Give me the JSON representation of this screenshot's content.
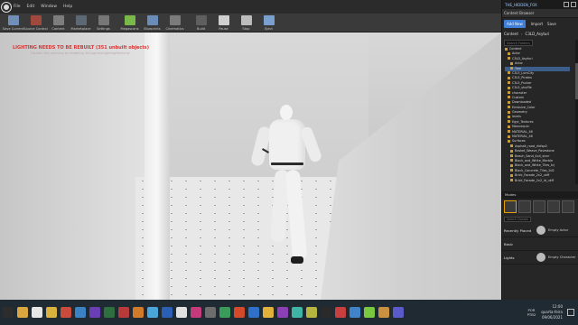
{
  "menu": {
    "items": [
      "File",
      "Edit",
      "Window",
      "Help"
    ]
  },
  "toolbar": {
    "buttons": [
      {
        "label": "Save Current",
        "color": "#6f8fb6"
      },
      {
        "label": "Source Control",
        "color": "#a0483b"
      },
      {
        "label": "Content",
        "color": "#7d7d7d"
      },
      {
        "label": "Marketplace",
        "color": "#5d6875"
      },
      {
        "label": "Settings",
        "color": "#777777"
      },
      {
        "label": "Megascans",
        "color": "#7ab84a"
      },
      {
        "label": "Blueprints",
        "color": "#6a8db8"
      },
      {
        "label": "Cinematics",
        "color": "#7b7b7b"
      },
      {
        "label": "Build",
        "color": "#5f5f5f"
      },
      {
        "label": "Pause",
        "color": "#cfcfcf"
      },
      {
        "label": "Stop",
        "color": "#bcbcbc"
      },
      {
        "label": "Eject",
        "color": "#7aa0d0"
      }
    ]
  },
  "viewport": {
    "warning": "LIGHTING NEEDS TO BE REBUILT (351 unbuilt objects)",
    "subwarning": "Disable this warning by enabling 'bSuppressLightingWarning'"
  },
  "panel": {
    "window_title": "THE_HIDDEN_FOX",
    "tab": "Content Browser",
    "add_new": "Add New",
    "import": "Import",
    "save": "Save",
    "path": [
      "Content",
      "C3LD_Asyturi"
    ],
    "search_placeholder": "Search Folders",
    "tree": [
      {
        "label": "Content",
        "selected": false
      },
      {
        "label": "Actor",
        "selected": false
      },
      {
        "label": "C3LD_Asyturi",
        "selected": false
      },
      {
        "label": "Actor",
        "selected": false
      },
      {
        "label": "Tree",
        "selected": true
      },
      {
        "label": "C3L5_LumCity",
        "selected": false
      },
      {
        "label": "C3L5_Pirates",
        "selected": false
      },
      {
        "label": "C3L5_Pucker",
        "selected": false
      },
      {
        "label": "C3L5_shuffle",
        "selected": false
      },
      {
        "label": "character",
        "selected": false
      },
      {
        "label": "Custom",
        "selected": false
      },
      {
        "label": "Downloaded",
        "selected": false
      },
      {
        "label": "Emissive_Color",
        "selected": false
      },
      {
        "label": "Geometry",
        "selected": false
      },
      {
        "label": "levels",
        "selected": false
      },
      {
        "label": "Egyt_Textures",
        "selected": false
      },
      {
        "label": "Mannequin",
        "selected": false
      },
      {
        "label": "MATERIAL_46",
        "selected": false
      },
      {
        "label": "MATERIAL_46",
        "selected": false
      },
      {
        "label": "Surfaces",
        "selected": false
      },
      {
        "label": "Asphalt_road_rfofsp0",
        "selected": false
      },
      {
        "label": "Basket_Weave_Pavestone",
        "selected": false
      },
      {
        "label": "Beach_Sand_4x4_slvnr",
        "selected": false
      },
      {
        "label": "Black_and_White_Marble",
        "selected": false
      },
      {
        "label": "Black_and_White_Tiles_tcj",
        "selected": false
      },
      {
        "label": "Black_Concrete_Tiles_2d2",
        "selected": false
      },
      {
        "label": "Brick_Facade_2x2_ukff",
        "selected": false
      },
      {
        "label": "Brick_Facade_2x2_ld_ukff",
        "selected": false
      }
    ],
    "modes_title": "Modes",
    "place_search": "Search Classes",
    "place_rows": [
      {
        "category": "Recently Placed",
        "item": "Empty Actor"
      },
      {
        "category": "Basic",
        "item": ""
      },
      {
        "category": "Lights",
        "item": "Empty Character"
      }
    ]
  },
  "taskbar": {
    "icons": [
      {
        "name": "start-icon",
        "color": "#2d2d2d"
      },
      {
        "name": "chrome-icon",
        "color": "#d9a640"
      },
      {
        "name": "unreal-icon",
        "color": "#e6e6e6"
      },
      {
        "name": "folder-icon",
        "color": "#d8b13f"
      },
      {
        "name": "app-icon",
        "color": "#c84b3b"
      },
      {
        "name": "app-icon",
        "color": "#3b82c4"
      },
      {
        "name": "app-icon",
        "color": "#6a3fb5"
      },
      {
        "name": "app-icon",
        "color": "#2e6e3f"
      },
      {
        "name": "app-icon",
        "color": "#b83a3a"
      },
      {
        "name": "app-icon",
        "color": "#d07a2a"
      },
      {
        "name": "app-icon",
        "color": "#4aa6d8"
      },
      {
        "name": "app-icon",
        "color": "#2b5fb5"
      },
      {
        "name": "app-icon",
        "color": "#e0e0e0"
      },
      {
        "name": "app-icon",
        "color": "#c53a7a"
      },
      {
        "name": "app-icon",
        "color": "#6d6d6d"
      },
      {
        "name": "app-icon",
        "color": "#3a9c5a"
      },
      {
        "name": "app-icon",
        "color": "#d24a2a"
      },
      {
        "name": "app-icon",
        "color": "#2f70c8"
      },
      {
        "name": "app-icon",
        "color": "#e2b13c"
      },
      {
        "name": "app-icon",
        "color": "#8d3fb5"
      },
      {
        "name": "app-icon",
        "color": "#3fb5a6"
      },
      {
        "name": "app-icon",
        "color": "#b5b53f"
      },
      {
        "name": "app-icon",
        "color": "#2a2a2a"
      },
      {
        "name": "app-icon",
        "color": "#c83f3f"
      },
      {
        "name": "app-icon",
        "color": "#3f83c8"
      },
      {
        "name": "app-icon",
        "color": "#7ac83f"
      },
      {
        "name": "app-icon",
        "color": "#c8903f"
      },
      {
        "name": "app-icon",
        "color": "#5a5ac8"
      }
    ],
    "lang": "POR\nPTB2",
    "time": "12:00",
    "day": "quarta-feira",
    "date": "09/06/2021"
  }
}
